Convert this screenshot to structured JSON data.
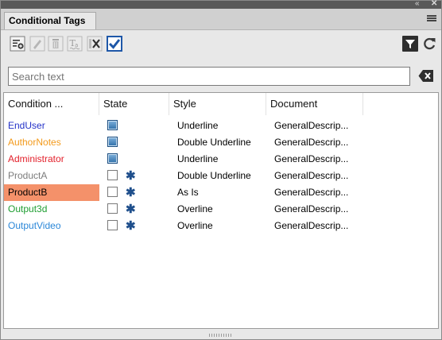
{
  "window": {
    "collapse_glyph": "«",
    "close_glyph": "✕"
  },
  "panel": {
    "tab_label": "Conditional Tags"
  },
  "toolbar": {
    "left_icons": [
      "new-tag-icon",
      "edit-tag-icon",
      "delete-tag-icon",
      "text-format-icon",
      "remove-tag-icon",
      "apply-checkbox-icon"
    ],
    "right_icons": [
      "filter-icon",
      "refresh-icon"
    ]
  },
  "search": {
    "placeholder": "Search text",
    "value": ""
  },
  "table": {
    "columns": [
      "Condition ...",
      "State",
      "Style",
      "Document"
    ],
    "rows": [
      {
        "condition": "EndUser",
        "color": "#2432c8",
        "state": "checked",
        "asterisk": "",
        "style": "Underline",
        "document": "GeneralDescrip..."
      },
      {
        "condition": "AuthorNotes",
        "color": "#f39a1b",
        "state": "checked",
        "asterisk": "",
        "style": "Double Underline",
        "document": "GeneralDescrip..."
      },
      {
        "condition": "Administrator",
        "color": "#e3202b",
        "state": "checked",
        "asterisk": "",
        "style": "Underline",
        "document": "GeneralDescrip..."
      },
      {
        "condition": "ProductA",
        "color": "#7c7c7c",
        "state": "unchecked",
        "asterisk": "✱",
        "style": "Double Underline",
        "document": "GeneralDescrip..."
      },
      {
        "condition": "ProductB",
        "color": "#000000",
        "state": "unchecked",
        "asterisk": "✱",
        "style": "As Is",
        "document": "GeneralDescrip...",
        "selected": true
      },
      {
        "condition": "Output3d",
        "color": "#1f9e32",
        "state": "unchecked",
        "asterisk": "✱",
        "style": "Overline",
        "document": "GeneralDescrip..."
      },
      {
        "condition": "OutputVideo",
        "color": "#2b87d8",
        "state": "unchecked",
        "asterisk": "✱",
        "style": "Overline",
        "document": "GeneralDescrip..."
      }
    ]
  },
  "colors": {
    "selection": "#f4916a",
    "checked_state": "#2f6ea8",
    "asterisk": "#1f4f8c"
  }
}
